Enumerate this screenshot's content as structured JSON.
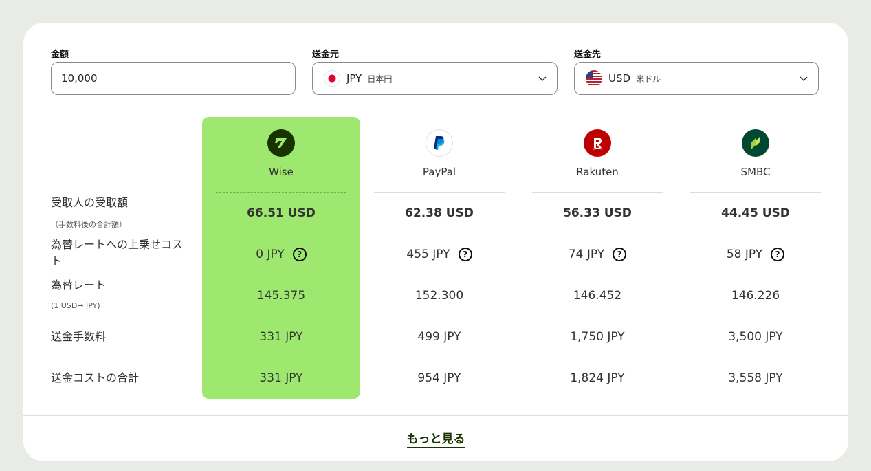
{
  "form": {
    "amount": {
      "label": "金額",
      "value": "10,000"
    },
    "source": {
      "label": "送金元",
      "code": "JPY",
      "name": "日本円"
    },
    "target": {
      "label": "送金先",
      "code": "USD",
      "name": "米ドル"
    }
  },
  "providers": [
    {
      "name": "Wise",
      "received": "66.51 USD",
      "markup": "0 JPY",
      "rate": "145.375",
      "fee": "331 JPY",
      "total": "331 JPY",
      "color": "#163300"
    },
    {
      "name": "PayPal",
      "received": "62.38 USD",
      "markup": "455 JPY",
      "rate": "152.300",
      "fee": "499 JPY",
      "total": "954 JPY",
      "color": "#003087"
    },
    {
      "name": "Rakuten",
      "received": "56.33 USD",
      "markup": "74 JPY",
      "rate": "146.452",
      "fee": "1,750 JPY",
      "total": "1,824 JPY",
      "color": "#bf0000"
    },
    {
      "name": "SMBC",
      "received": "44.45 USD",
      "markup": "58 JPY",
      "rate": "146.226",
      "fee": "3,500 JPY",
      "total": "3,558 JPY",
      "color": "#004831"
    }
  ],
  "rows": {
    "received": {
      "label": "受取人の受取額",
      "sub": "（手数料後の合計額）"
    },
    "markup": {
      "label": "為替レートへの上乗せコスト"
    },
    "rate": {
      "label": "為替レート",
      "sub": "(1 USD→ JPY)"
    },
    "fee": {
      "label": "送金手数料"
    },
    "total": {
      "label": "送金コストの合計"
    }
  },
  "more_label": "もっと見る",
  "colors": {
    "wise_highlight": "#9fe870",
    "background": "#e9ebe7"
  }
}
